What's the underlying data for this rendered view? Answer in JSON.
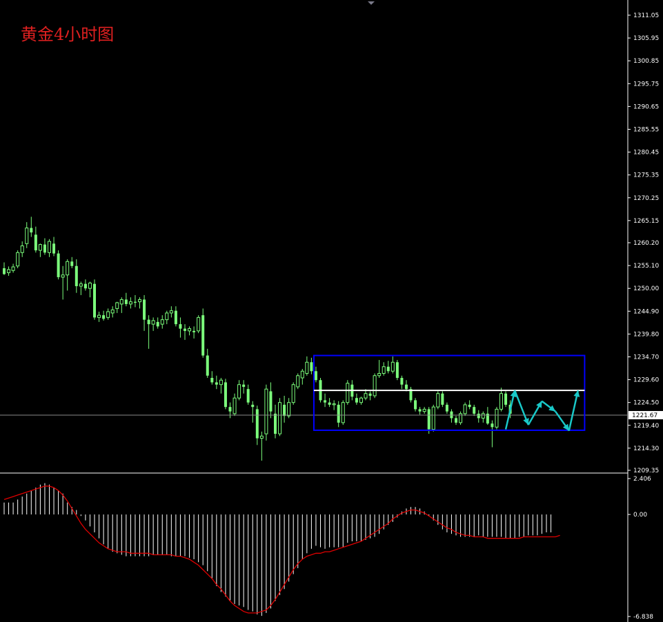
{
  "title": "黄金4小时图",
  "colors": {
    "background": "#000000",
    "axis": "#ffffff",
    "candle": "#7cff7c",
    "box": "#0000ff",
    "level": "#ffffff",
    "histogram": "#ffffff",
    "signal": "#e00000",
    "arrow": "#19c8c8",
    "title": "#e02020"
  },
  "chart_data": [
    {
      "type": "candlestick",
      "title": "黄金4小时图",
      "y_ticks": [
        "1311.05",
        "1305.95",
        "1300.85",
        "1295.75",
        "1290.65",
        "1285.55",
        "1280.45",
        "1275.35",
        "1270.25",
        "1265.15",
        "1260.20",
        "1255.10",
        "1250.00",
        "1244.90",
        "1239.80",
        "1234.70",
        "1229.60",
        "1224.50",
        "1219.40",
        "1214.30",
        "1209.35"
      ],
      "ylim": [
        1209.35,
        1311.05
      ],
      "current_price": "1221.67",
      "current_price_value": 1221.67,
      "resistance_level": 1227.2,
      "range_box": {
        "start_index": 69,
        "end_index": 128,
        "top": 1235.0,
        "bottom": 1218.3
      },
      "ohlc": [
        [
          1254.5,
          1255.8,
          1253.0,
          1253.2
        ],
        [
          1253.5,
          1254.9,
          1252.8,
          1254.2
        ],
        [
          1254.0,
          1255.5,
          1253.5,
          1254.8
        ],
        [
          1255.0,
          1258.5,
          1254.5,
          1258.0
        ],
        [
          1258.0,
          1260.5,
          1257.0,
          1259.5
        ],
        [
          1260.0,
          1264.8,
          1259.0,
          1263.5
        ],
        [
          1263.5,
          1266.0,
          1261.5,
          1262.5
        ],
        [
          1262.0,
          1263.8,
          1258.0,
          1258.5
        ],
        [
          1258.5,
          1260.0,
          1257.0,
          1259.8
        ],
        [
          1259.8,
          1261.2,
          1257.5,
          1258.0
        ],
        [
          1258.0,
          1261.0,
          1257.0,
          1260.5
        ],
        [
          1260.0,
          1261.5,
          1257.2,
          1257.8
        ],
        [
          1257.8,
          1258.5,
          1252.0,
          1252.5
        ],
        [
          1252.5,
          1255.0,
          1247.5,
          1253.0
        ],
        [
          1253.0,
          1256.5,
          1249.5,
          1256.0
        ],
        [
          1256.0,
          1257.0,
          1254.5,
          1255.0
        ],
        [
          1255.0,
          1256.5,
          1249.0,
          1250.5
        ],
        [
          1250.5,
          1251.5,
          1248.5,
          1251.0
        ],
        [
          1251.0,
          1252.0,
          1249.5,
          1250.0
        ],
        [
          1250.0,
          1251.5,
          1248.0,
          1251.2
        ],
        [
          1251.0,
          1252.0,
          1243.0,
          1243.5
        ],
        [
          1243.5,
          1244.8,
          1242.5,
          1244.0
        ],
        [
          1244.0,
          1245.0,
          1242.8,
          1243.2
        ],
        [
          1243.5,
          1245.5,
          1243.0,
          1244.8
        ],
        [
          1244.5,
          1246.0,
          1243.5,
          1245.2
        ],
        [
          1245.5,
          1247.0,
          1244.5,
          1246.8
        ],
        [
          1246.5,
          1248.0,
          1244.5,
          1247.5
        ],
        [
          1247.5,
          1249.0,
          1246.0,
          1246.5
        ],
        [
          1246.5,
          1248.0,
          1245.5,
          1247.0
        ],
        [
          1247.0,
          1248.5,
          1245.8,
          1246.8
        ],
        [
          1247.0,
          1248.0,
          1245.5,
          1247.5
        ],
        [
          1247.5,
          1248.5,
          1240.5,
          1243.0
        ],
        [
          1243.0,
          1244.0,
          1236.5,
          1242.0
        ],
        [
          1242.0,
          1243.5,
          1240.5,
          1242.8
        ],
        [
          1242.5,
          1243.5,
          1241.0,
          1241.5
        ],
        [
          1242.0,
          1244.0,
          1241.0,
          1243.0
        ],
        [
          1243.0,
          1245.0,
          1242.0,
          1244.5
        ],
        [
          1244.5,
          1246.0,
          1243.5,
          1245.0
        ],
        [
          1245.0,
          1246.0,
          1241.5,
          1242.0
        ],
        [
          1242.0,
          1243.5,
          1239.0,
          1241.0
        ],
        [
          1241.0,
          1242.0,
          1238.5,
          1240.5
        ],
        [
          1240.5,
          1241.5,
          1239.5,
          1241.0
        ],
        [
          1240.5,
          1241.5,
          1238.8,
          1240.2
        ],
        [
          1240.5,
          1244.0,
          1240.0,
          1243.5
        ],
        [
          1244.0,
          1245.5,
          1234.5,
          1235.0
        ],
        [
          1235.0,
          1236.5,
          1230.0,
          1230.5
        ],
        [
          1230.0,
          1231.5,
          1228.5,
          1229.0
        ],
        [
          1229.0,
          1230.5,
          1227.5,
          1228.5
        ],
        [
          1228.5,
          1230.0,
          1226.5,
          1229.5
        ],
        [
          1229.0,
          1229.8,
          1223.0,
          1223.5
        ],
        [
          1223.5,
          1224.5,
          1221.0,
          1222.5
        ],
        [
          1222.0,
          1226.5,
          1221.5,
          1225.5
        ],
        [
          1225.5,
          1229.5,
          1225.0,
          1228.5
        ],
        [
          1228.5,
          1229.5,
          1226.5,
          1228.0
        ],
        [
          1227.5,
          1228.5,
          1224.0,
          1224.5
        ],
        [
          1224.0,
          1224.8,
          1220.0,
          1223.5
        ],
        [
          1223.0,
          1223.8,
          1215.0,
          1216.5
        ],
        [
          1216.5,
          1218.0,
          1211.5,
          1217.0
        ],
        [
          1217.5,
          1228.5,
          1216.0,
          1227.5
        ],
        [
          1227.0,
          1229.0,
          1221.0,
          1222.5
        ],
        [
          1222.0,
          1224.0,
          1216.5,
          1217.5
        ],
        [
          1217.5,
          1225.5,
          1217.0,
          1224.5
        ],
        [
          1224.0,
          1226.0,
          1220.0,
          1221.5
        ],
        [
          1221.5,
          1225.5,
          1221.0,
          1224.5
        ],
        [
          1224.5,
          1229.0,
          1224.0,
          1228.5
        ],
        [
          1228.0,
          1231.0,
          1227.5,
          1230.5
        ],
        [
          1230.0,
          1232.0,
          1228.5,
          1231.5
        ],
        [
          1231.0,
          1234.8,
          1230.5,
          1233.5
        ],
        [
          1233.5,
          1234.5,
          1230.8,
          1231.5
        ],
        [
          1231.5,
          1232.5,
          1229.0,
          1229.5
        ],
        [
          1229.5,
          1230.0,
          1224.5,
          1225.0
        ],
        [
          1225.0,
          1226.5,
          1223.5,
          1224.5
        ],
        [
          1224.5,
          1225.5,
          1223.5,
          1224.0
        ],
        [
          1224.0,
          1225.0,
          1222.8,
          1224.2
        ],
        [
          1224.0,
          1224.8,
          1219.0,
          1220.0
        ],
        [
          1220.0,
          1225.0,
          1219.5,
          1224.5
        ],
        [
          1224.5,
          1229.5,
          1224.0,
          1228.8
        ],
        [
          1228.5,
          1229.5,
          1225.0,
          1225.8
        ],
        [
          1225.5,
          1226.5,
          1224.0,
          1224.5
        ],
        [
          1224.5,
          1225.8,
          1224.0,
          1225.5
        ],
        [
          1225.5,
          1227.5,
          1225.0,
          1226.5
        ],
        [
          1226.5,
          1227.0,
          1225.0,
          1226.0
        ],
        [
          1226.0,
          1231.0,
          1225.5,
          1230.5
        ],
        [
          1230.5,
          1234.0,
          1230.0,
          1231.0
        ],
        [
          1231.0,
          1233.5,
          1230.5,
          1232.5
        ],
        [
          1232.5,
          1233.8,
          1231.0,
          1231.5
        ],
        [
          1231.5,
          1234.8,
          1231.0,
          1233.5
        ],
        [
          1233.5,
          1234.0,
          1229.5,
          1230.0
        ],
        [
          1230.0,
          1230.5,
          1227.5,
          1228.5
        ],
        [
          1228.5,
          1229.5,
          1227.0,
          1227.5
        ],
        [
          1227.5,
          1228.0,
          1224.5,
          1225.0
        ],
        [
          1225.0,
          1225.5,
          1222.5,
          1223.0
        ],
        [
          1223.0,
          1223.5,
          1221.8,
          1222.5
        ],
        [
          1222.5,
          1223.5,
          1222.0,
          1223.0
        ],
        [
          1223.0,
          1223.5,
          1217.5,
          1218.5
        ],
        [
          1218.5,
          1224.0,
          1218.0,
          1223.5
        ],
        [
          1223.5,
          1227.0,
          1223.0,
          1226.5
        ],
        [
          1226.5,
          1227.0,
          1223.5,
          1224.0
        ],
        [
          1224.0,
          1224.5,
          1222.0,
          1222.5
        ],
        [
          1222.5,
          1223.0,
          1220.0,
          1221.0
        ],
        [
          1221.0,
          1221.5,
          1219.5,
          1220.0
        ],
        [
          1220.0,
          1222.5,
          1219.5,
          1222.0
        ],
        [
          1222.0,
          1224.5,
          1221.5,
          1224.0
        ],
        [
          1224.0,
          1225.0,
          1223.0,
          1223.5
        ],
        [
          1223.5,
          1224.0,
          1221.5,
          1222.0
        ],
        [
          1222.0,
          1222.8,
          1220.0,
          1221.0
        ],
        [
          1221.0,
          1222.5,
          1220.0,
          1222.0
        ],
        [
          1222.0,
          1223.5,
          1219.5,
          1219.8
        ],
        [
          1219.8,
          1220.5,
          1214.5,
          1219.0
        ],
        [
          1219.0,
          1223.5,
          1218.5,
          1223.0
        ],
        [
          1223.0,
          1227.8,
          1222.5,
          1226.5
        ],
        [
          1226.5,
          1227.0,
          1223.5,
          1224.0
        ],
        [
          1224.0,
          1225.0,
          1221.0,
          1222.0
        ]
      ],
      "arrows": [
        {
          "from": [
            111,
            1218.5
          ],
          "to": [
            113,
            1227.2
          ]
        },
        {
          "from": [
            113,
            1227.2
          ],
          "to": [
            116,
            1219.5
          ]
        },
        {
          "from": [
            116,
            1219.5
          ],
          "to": [
            119,
            1224.8
          ]
        },
        {
          "from": [
            119,
            1224.8
          ],
          "to": [
            122,
            1222.5
          ]
        },
        {
          "from": [
            122,
            1222.5
          ],
          "to": [
            125,
            1218.2
          ]
        },
        {
          "from": [
            125,
            1218.2
          ],
          "to": [
            127,
            1227.2
          ]
        }
      ],
      "indicator": {
        "y_ticks": [
          "2.406",
          "0.00",
          "-6.838"
        ],
        "ylim": [
          -6.838,
          2.406
        ],
        "histogram": [
          0.8,
          0.8,
          0.8,
          1.0,
          1.2,
          1.4,
          1.6,
          1.8,
          2.0,
          2.1,
          2.0,
          1.8,
          1.6,
          1.4,
          0.8,
          0.5,
          0.3,
          -0.1,
          -0.4,
          -0.8,
          -1.2,
          -1.6,
          -2.0,
          -2.3,
          -2.5,
          -2.6,
          -2.7,
          -2.8,
          -2.8,
          -2.8,
          -2.8,
          -2.8,
          -2.8,
          -2.7,
          -2.7,
          -2.7,
          -2.7,
          -2.8,
          -2.8,
          -2.8,
          -2.8,
          -2.9,
          -3.0,
          -3.2,
          -3.4,
          -3.8,
          -4.3,
          -4.8,
          -5.2,
          -5.5,
          -5.8,
          -6.0,
          -6.1,
          -6.2,
          -6.4,
          -6.5,
          -6.7,
          -6.8,
          -6.6,
          -6.3,
          -5.8,
          -5.4,
          -5.0,
          -4.5,
          -4.0,
          -3.6,
          -3.0,
          -2.6,
          -2.3,
          -2.1,
          -2.2,
          -2.3,
          -2.2,
          -2.2,
          -2.2,
          -2.2,
          -1.9,
          -1.8,
          -1.8,
          -1.8,
          -1.7,
          -1.6,
          -1.5,
          -1.3,
          -1.0,
          -0.7,
          -0.5,
          -0.2,
          0.2,
          0.4,
          0.5,
          0.5,
          0.4,
          0.2,
          -0.1,
          -0.4,
          -0.7,
          -1.0,
          -1.2,
          -1.3,
          -1.4,
          -1.5,
          -1.5,
          -1.5,
          -1.5,
          -1.4,
          -1.5,
          -1.5,
          -1.5,
          -1.5,
          -1.5,
          -1.6,
          -1.6,
          -1.6,
          -1.5,
          -1.5,
          -1.4,
          -1.4,
          -1.4,
          -1.3,
          -1.2,
          -1.2
        ],
        "signal": [
          1.0,
          1.1,
          1.2,
          1.3,
          1.4,
          1.5,
          1.6,
          1.7,
          1.8,
          1.9,
          1.9,
          1.8,
          1.6,
          1.3,
          0.9,
          0.4,
          -0.1,
          -0.6,
          -1.0,
          -1.3,
          -1.6,
          -1.9,
          -2.1,
          -2.3,
          -2.4,
          -2.5,
          -2.5,
          -2.5,
          -2.6,
          -2.6,
          -2.6,
          -2.6,
          -2.6,
          -2.7,
          -2.7,
          -2.7,
          -2.7,
          -2.7,
          -2.8,
          -2.8,
          -2.9,
          -3.0,
          -3.2,
          -3.4,
          -3.7,
          -4.0,
          -4.3,
          -4.7,
          -5.0,
          -5.4,
          -5.8,
          -6.1,
          -6.3,
          -6.5,
          -6.6,
          -6.6,
          -6.6,
          -6.5,
          -6.4,
          -6.1,
          -5.7,
          -5.2,
          -4.7,
          -4.2,
          -3.7,
          -3.3,
          -3.0,
          -2.8,
          -2.7,
          -2.6,
          -2.6,
          -2.5,
          -2.5,
          -2.4,
          -2.3,
          -2.2,
          -2.1,
          -2.0,
          -1.9,
          -1.8,
          -1.6,
          -1.4,
          -1.2,
          -1.0,
          -0.8,
          -0.6,
          -0.3,
          -0.1,
          0.1,
          0.2,
          0.3,
          0.3,
          0.2,
          0.1,
          -0.1,
          -0.3,
          -0.5,
          -0.7,
          -0.9,
          -1.0,
          -1.2,
          -1.3,
          -1.4,
          -1.4,
          -1.5,
          -1.5,
          -1.5,
          -1.6,
          -1.6,
          -1.6,
          -1.6,
          -1.6,
          -1.6,
          -1.6,
          -1.6,
          -1.5,
          -1.5,
          -1.5,
          -1.5,
          -1.5,
          -1.5,
          -1.5,
          -1.5,
          -1.4
        ]
      }
    }
  ]
}
